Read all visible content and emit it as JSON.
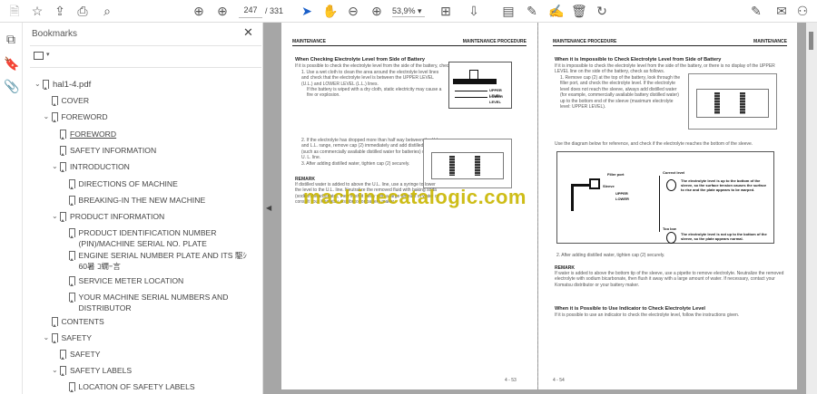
{
  "toolbar": {
    "page_current": "247",
    "page_total": "/ 331",
    "zoom": "53,9%",
    "zoom_caret": "▾"
  },
  "sidebar": {
    "title": "Bookmarks",
    "close": "✕",
    "options_caret": "▾",
    "items": [
      {
        "label": "hal1-4.pdf",
        "level": 0,
        "expanded": true
      },
      {
        "label": "COVER",
        "level": 1
      },
      {
        "label": "FOREWORD",
        "level": 1,
        "expanded": true
      },
      {
        "label": "FOREWORD",
        "level": 2,
        "current": true
      },
      {
        "label": "SAFETY INFORMATION",
        "level": 2
      },
      {
        "label": "INTRODUCTION",
        "level": 2,
        "expanded": true
      },
      {
        "label": "DIRECTIONS OF MACHINE",
        "level": 3
      },
      {
        "label": "BREAKING-IN THE NEW MACHINE",
        "level": 3
      },
      {
        "label": "PRODUCT INFORMATION",
        "level": 2,
        "expanded": true
      },
      {
        "label": "PRODUCT IDENTIFICATION NUMBER (PIN)/MACHINE SERIAL NO. PLATE",
        "level": 3
      },
      {
        "label": "ENGINE SERIAL NUMBER PLATE AND ITS 駆ｼ60暑 ｺ繝ｰ言",
        "level": 3
      },
      {
        "label": "SERVICE METER LOCATION",
        "level": 3
      },
      {
        "label": "YOUR MACHINE SERIAL NUMBERS AND DISTRIBUTOR",
        "level": 3
      },
      {
        "label": "CONTENTS",
        "level": 1
      },
      {
        "label": "SAFETY",
        "level": 1,
        "expanded": true
      },
      {
        "label": "SAFETY",
        "level": 2
      },
      {
        "label": "SAFETY LABELS",
        "level": 2,
        "expanded": true
      },
      {
        "label": "LOCATION OF SAFETY LABELS",
        "level": 3
      }
    ]
  },
  "left_page": {
    "header_left": "MAINTENANCE",
    "header_right": "MAINTENANCE PROCEDURE",
    "heading": "When Checking Electrolyte Level from Side of Battery",
    "intro": "If it is possible to check the electrolyte level from the side of the battery, check as follows.",
    "step1": "1. Use a wet cloth to clean the area around the electrolyte level lines and check that the electrolyte level is between the UPPER LEVEL (U.L.) and LOWER LEVEL (L.L.) lines.",
    "step1_note": "If the battery is wiped with a dry cloth, static electricity may cause a fire or explosion.",
    "fig_upper": "UPPER LEVEL",
    "fig_lower": "LOWER LEVEL",
    "step2": "2. If the electrolyte has dropped more than half way between the U.L. and L.L. range, remove cap (2) immediately and add distilled water (such as commercially available distilled water for batteries) up to the U. L. line.",
    "step3": "3. After adding distilled water, tighten cap (2) securely.",
    "remark_title": "REMARK",
    "remark": "If distilled water is added to above the U.L. line, use a syringe to lower the level to the U.L. line. Neutralize the removed fluid with baking soda (sodium bicarbonate), then flush it away with a large amount of water or consult your Komatsu distributor or battery maker.",
    "page_no": "4 - 53"
  },
  "right_page": {
    "header_left": "MAINTENANCE PROCEDURE",
    "header_right": "MAINTENANCE",
    "heading": "When it is Impossible to Check Electrolyte Level from Side of Battery",
    "intro": "If it is impossible to check the electrolyte level from the side of the battery, or there is no display of the UPPER LEVEL line on the side of the battery, check as follows.",
    "step1": "1. Remove cap (2) at the top of the battery, look through the filler port, and check the electrolyte level. If the electrolyte level does not reach the sleeve, always add distilled water (for example, commercially available battery distilled water) up to the bottom end of the sleeve (maximum electrolyte level: UPPER LEVEL).",
    "diagram_intro": "Use the diagram below for reference, and check if the electrolyte reaches the bottom of the sleeve.",
    "diagram": {
      "filler_port": "Filler port",
      "sleeve": "Sleeve",
      "upper": "UPPER",
      "lower": "LOWER",
      "correct_level": "Correct level",
      "correct_text": "The electrolyte level is up to the bottom of the sleeve, so the surface tension causes the surface to rise and the plate appears to be warped.",
      "too_low": "Too low",
      "too_low_text": "The electrolyte level is not up to the bottom of the sleeve, so the plate appears normal."
    },
    "step2": "2. After adding distilled water, tighten cap (2) securely.",
    "remark_title": "REMARK",
    "remark": "If water is added to above the bottom tip of the sleeve, use a pipette to remove electrolyte. Neutralize the removed electrolyte with sodium bicarbonate, then flush it away with a large amount of water. If necessary, contact your Komatsu distributor or your battery maker.",
    "heading2": "When it is Possible to Use Indicator to Check Electrolyte Level",
    "intro2": "If it is possible to use an indicator to check the electrolyte level, follow the instructions given.",
    "page_no": "4 - 54"
  },
  "watermark": "machinecatalogic.com"
}
